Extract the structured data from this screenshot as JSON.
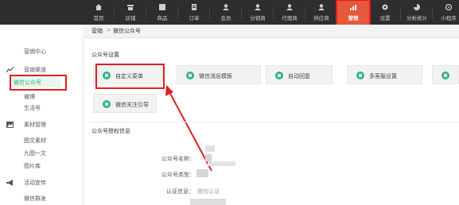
{
  "nav": {
    "items": [
      {
        "label": "首页",
        "icon": "home-icon"
      },
      {
        "label": "店铺",
        "icon": "store-icon"
      },
      {
        "label": "商品",
        "icon": "goods-icon"
      },
      {
        "label": "订单",
        "icon": "order-icon"
      },
      {
        "label": "会员",
        "icon": "member-icon"
      },
      {
        "label": "分销商",
        "icon": "distributor-icon"
      },
      {
        "label": "代理商",
        "icon": "agent-icon"
      },
      {
        "label": "供应商",
        "icon": "supplier-icon"
      },
      {
        "label": "营销",
        "icon": "marketing-icon"
      },
      {
        "label": "设置",
        "icon": "gear-icon"
      },
      {
        "label": "分析统计",
        "icon": "chart-icon"
      },
      {
        "label": "小程序",
        "icon": "mini-program-icon"
      }
    ],
    "active": "营销",
    "highlight_color": "#e02020",
    "active_bg": "#e8583b"
  },
  "breadcrumb": {
    "root": "营销",
    "separator": ">",
    "current": "微信公众号"
  },
  "sidebar": {
    "marketing_center": "营销中心",
    "channel_group": "营销渠道",
    "wechat_mp": "微信公众号",
    "weibo": "微博",
    "life_account": "生活号",
    "material_group": "素材管理",
    "article_material": "图文素材",
    "nine_grid": "九图一文",
    "gallery": "图片库",
    "activity_group": "活动宣传",
    "wechat_mass": "微信群发"
  },
  "settings": {
    "title": "公众号设置",
    "cards": [
      {
        "label": "自定义菜单",
        "icon": "list-icon"
      },
      {
        "label": "微信消息模板",
        "icon": "template-icon"
      },
      {
        "label": "自动回复",
        "icon": "reply-icon"
      },
      {
        "label": "多客服设置",
        "icon": "headset-icon"
      },
      {
        "label": "微信关注引导",
        "icon": "follow-guide-icon"
      }
    ],
    "accent": "#2fb57a"
  },
  "auth": {
    "title": "公众号授权信息",
    "name_label": "公众号名称：",
    "type_label": "公众号类型：",
    "cert_label": "认证信息：",
    "cert_value": "微信认证"
  }
}
